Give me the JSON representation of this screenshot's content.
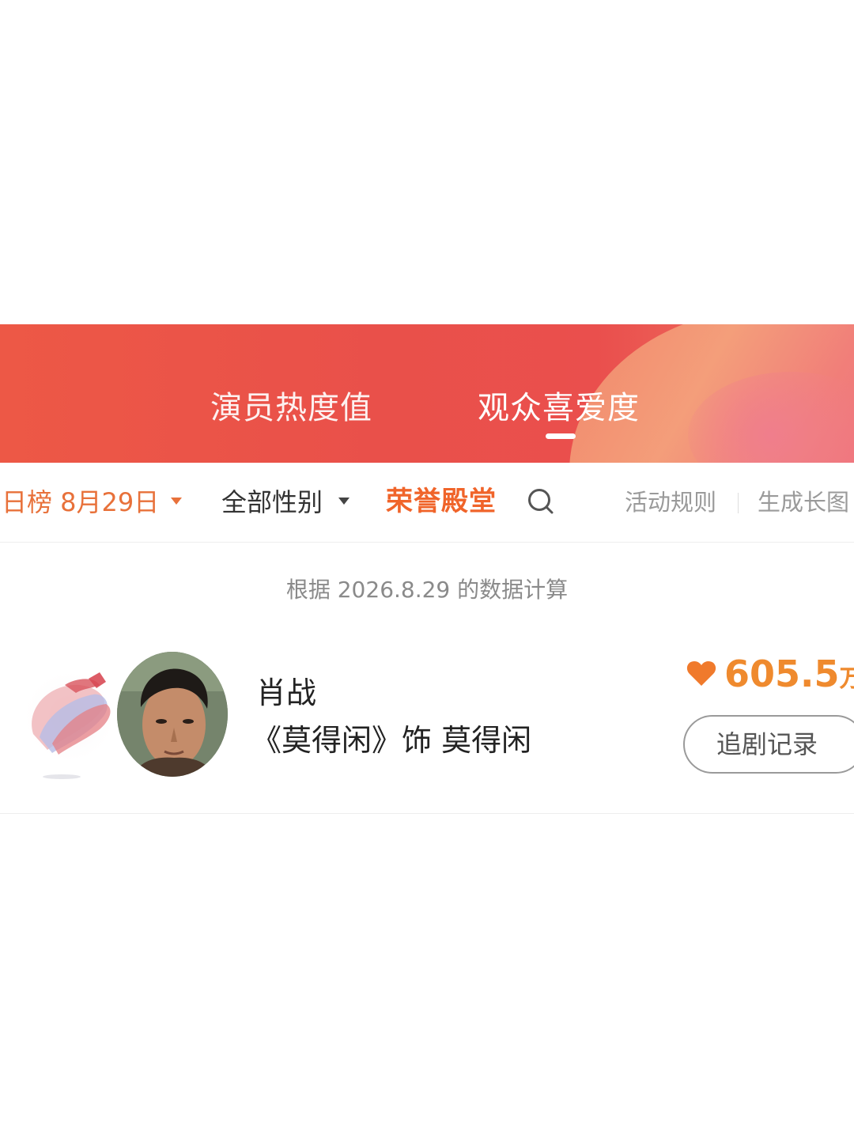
{
  "header": {
    "tabs": [
      {
        "label": "演员热度值",
        "active": false
      },
      {
        "label": "观众喜爱度",
        "active": true
      }
    ],
    "colors": {
      "banner": "#e9504a",
      "accent": "#f0642a"
    }
  },
  "filters": {
    "date_label": "日榜 8月29日",
    "gender_label": "全部性别",
    "honor_label": "荣誉殿堂",
    "rules_label": "活动规则",
    "long_image_label": "生成长图"
  },
  "note": "根据 2026.8.29 的数据计算",
  "ranking": [
    {
      "name": "肖战",
      "role": "《莫得闲》饰 莫得闲",
      "score": "605.5",
      "score_unit": "万",
      "record_button": "追剧记录",
      "icons": {
        "score": "heart-icon",
        "badge": "rank-badge"
      }
    }
  ]
}
